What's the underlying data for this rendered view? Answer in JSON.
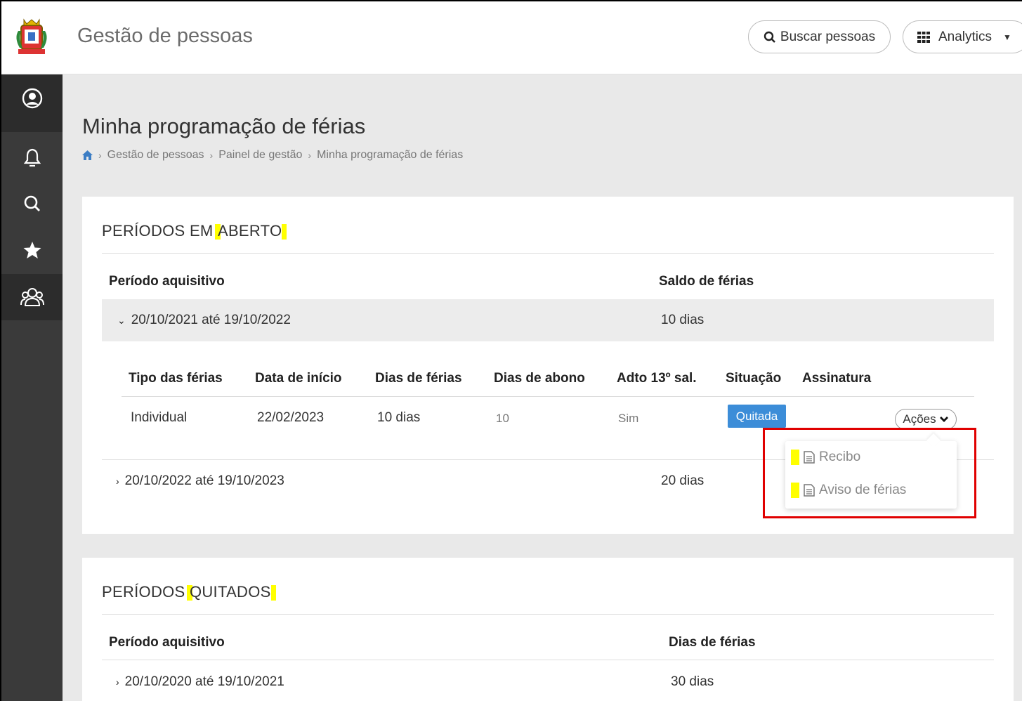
{
  "header": {
    "app_title": "Gestão de pessoas",
    "search_button": "Buscar pessoas",
    "analytics_button": "Analytics"
  },
  "sidebar": {
    "items": [
      {
        "icon": "user-circle-icon"
      },
      {
        "icon": "bell-icon"
      },
      {
        "icon": "search-icon"
      },
      {
        "icon": "star-icon"
      },
      {
        "icon": "team-icon"
      }
    ]
  },
  "page": {
    "title": "Minha programação de férias",
    "breadcrumb": [
      "Gestão de pessoas",
      "Painel de gestão",
      "Minha programação de férias"
    ]
  },
  "open_periods": {
    "title": "PERÍODOS EM ABERTO",
    "title_parts": [
      "PERÍODOS EM ",
      "ABERTO"
    ],
    "col_period": "Período aquisitivo",
    "col_balance": "Saldo de férias",
    "rows": [
      {
        "period": "20/10/2021 até 19/10/2022",
        "balance": "10 dias",
        "expanded": true
      },
      {
        "period": "20/10/2022 até 19/10/2023",
        "balance": "20 dias",
        "expanded": false
      }
    ],
    "detail": {
      "headers": [
        "Tipo das férias",
        "Data de início",
        "Dias de férias",
        "Dias de abono",
        "Adto 13º sal.",
        "Situação",
        "Assinatura"
      ],
      "row": {
        "tipo": "Individual",
        "inicio": "22/02/2023",
        "dias": "10 dias",
        "abono": "10",
        "adto": "Sim",
        "situacao": "Quitada"
      },
      "actions_label": "Ações",
      "actions_menu": [
        "Recibo",
        "Aviso de férias"
      ]
    }
  },
  "paid_periods": {
    "title_parts": [
      "PERÍODOS ",
      "QUITADOS"
    ],
    "col_period": "Período aquisitivo",
    "col_days": "Dias de férias",
    "rows": [
      {
        "period": "20/10/2020 até 19/10/2021",
        "days": "30 dias"
      }
    ]
  },
  "colors": {
    "sidebar": "#3a3a3a",
    "badge": "#3c8dd8",
    "highlight": "#ffff00",
    "annotation": "#e00000"
  }
}
